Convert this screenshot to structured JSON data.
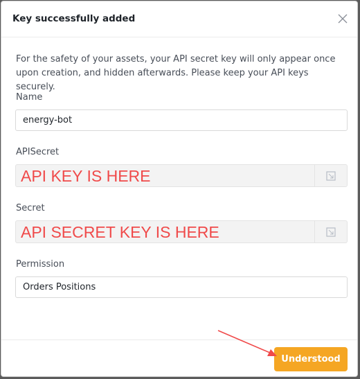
{
  "modal": {
    "title": "Key successfully added",
    "notice": "For the safety of your assets, your API secret key will only appear once upon creation, and hidden afterwards. Please keep your API keys securely.",
    "confirm_label": "Understood"
  },
  "fields": {
    "name": {
      "label": "Name",
      "value": "energy-bot"
    },
    "api_secret": {
      "label": "APISecret",
      "value": "API KEY IS HERE"
    },
    "secret": {
      "label": "Secret",
      "value": "API SECRET KEY IS HERE"
    },
    "permission": {
      "label": "Permission",
      "value": "Orders Positions"
    }
  },
  "icons": {
    "close": "close-icon",
    "copy": "copy-icon",
    "annotation": "red-arrow-annotation"
  },
  "colors": {
    "accent": "#f5a623",
    "annotation": "#f04a4a",
    "key_background": "#f3f3f3"
  }
}
